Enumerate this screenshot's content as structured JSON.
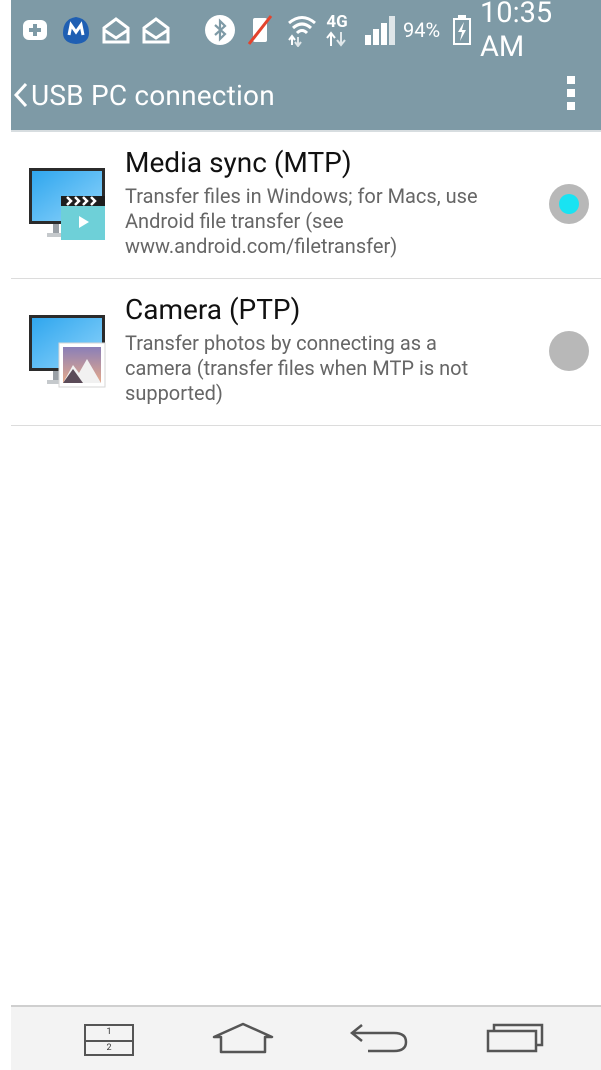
{
  "status_bar": {
    "battery_percent": "94%",
    "time": "10:35 AM",
    "network_label": "4G",
    "icons": [
      "health-plus-icon",
      "malwarebytes-icon",
      "email-open-icon",
      "email-open-icon",
      "bluetooth-icon",
      "vibrate-off-icon",
      "wifi-icon",
      "lte-4g-icon",
      "signal-bars-icon",
      "battery-charging-icon"
    ]
  },
  "header": {
    "title": "USB PC connection",
    "back_icon": "chevron-left-icon",
    "menu_icon": "overflow-menu-icon"
  },
  "options": [
    {
      "title": "Media sync (MTP)",
      "description": "Transfer files in Windows; for Macs, use\nAndroid file transfer (see\nwww.android.com/filetransfer)",
      "selected": true,
      "icon": "monitor-media-icon"
    },
    {
      "title": "Camera (PTP)",
      "description": "Transfer photos by connecting as a\ncamera (transfer files when MTP is not\nsupported)",
      "selected": false,
      "icon": "monitor-photo-icon"
    }
  ],
  "nav_bar": {
    "dual_window_labels": [
      "1",
      "2"
    ],
    "buttons": [
      "dual-window-icon",
      "home-icon",
      "back-icon",
      "recents-icon"
    ]
  },
  "colors": {
    "action_bar": "#7e9aa6",
    "radio_selected": "#19e3f2",
    "radio_unselected": "#b8b8b8"
  }
}
